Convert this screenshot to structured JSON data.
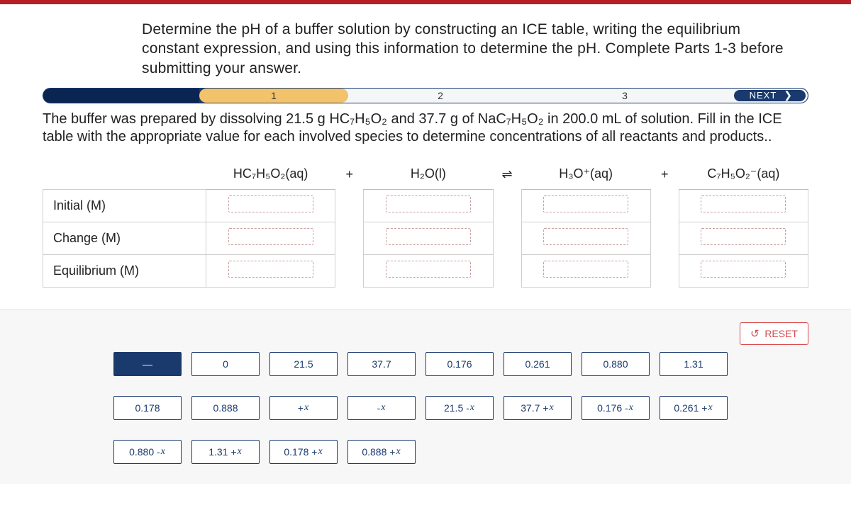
{
  "intro_text": "Determine the pH of a buffer solution by constructing an ICE table, writing the equilibrium constant expression, and using this information to determine the pH. Complete Parts 1-3 before submitting your answer.",
  "stepper": {
    "s1": "1",
    "s2": "2",
    "s3": "3",
    "next": "NEXT"
  },
  "sub_instr": "The buffer was prepared by dissolving 21.5 g HC₇H₅O₂ and 37.7 g of NaC₇H₅O₂ in 200.0 mL of solution. Fill in the ICE table with the appropriate value for each involved species to determine concentrations of all reactants and products..",
  "ice": {
    "rows": {
      "initial": "Initial (M)",
      "change": "Change (M)",
      "equil": "Equilibrium (M)"
    },
    "headers": {
      "acid": "HC₇H₅O₂(aq)",
      "water": "H₂O(l)",
      "hydronium": "H₃O⁺(aq)",
      "base": "C₇H₅O₂⁻(aq)",
      "plus": "+",
      "equil": "⇌"
    }
  },
  "reset_label": "RESET",
  "tiles_r1": [
    "—",
    "0",
    "21.5",
    "37.7",
    "0.176",
    "0.261",
    "0.880",
    "1.31"
  ],
  "tiles_r2": [
    "0.178",
    "0.888",
    "+x",
    "-x",
    "21.5 - x",
    "37.7 + x",
    "0.176 - x",
    "0.261 + x"
  ],
  "tiles_r3": [
    "0.880 - x",
    "1.31 + x",
    "0.178 + x",
    "0.888 + x"
  ]
}
